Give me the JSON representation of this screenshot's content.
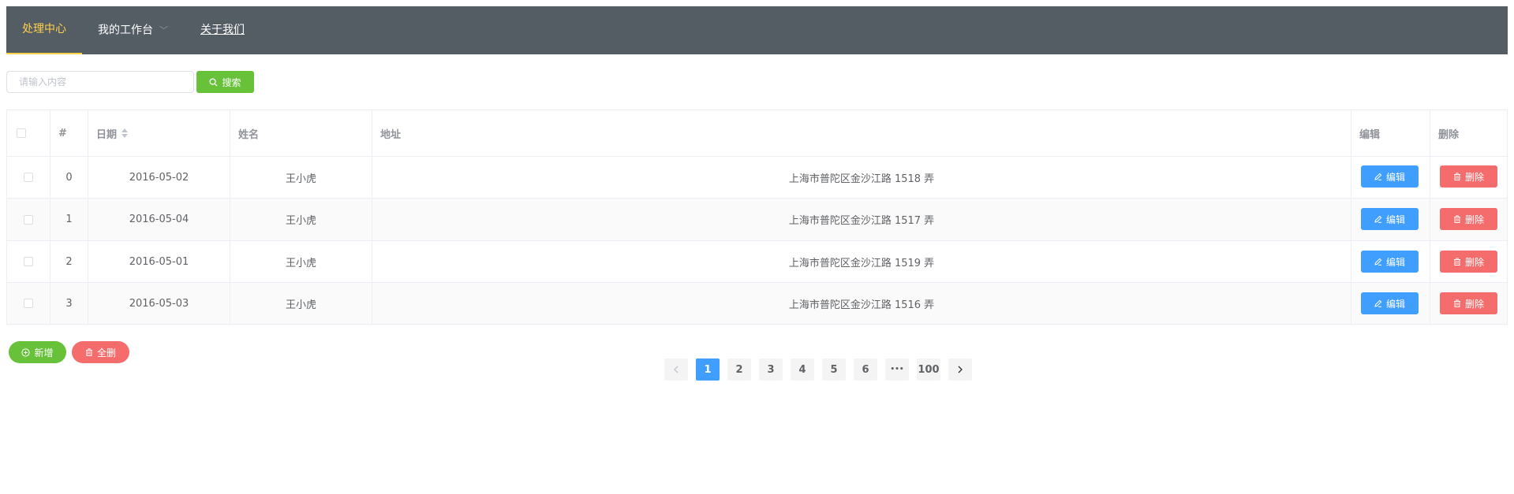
{
  "nav": {
    "items": [
      {
        "label": "处理中心"
      },
      {
        "label": "我的工作台"
      },
      {
        "label": "关于我们"
      }
    ]
  },
  "search": {
    "placeholder": "请输入内容",
    "button_label": "搜索"
  },
  "table": {
    "headers": {
      "index": "#",
      "date": "日期",
      "name": "姓名",
      "address": "地址",
      "edit": "编辑",
      "delete": "删除"
    },
    "rows": [
      {
        "index": "0",
        "date": "2016-05-02",
        "name": "王小虎",
        "address": "上海市普陀区金沙江路 1518 弄",
        "edit_label": "编辑",
        "delete_label": "删除"
      },
      {
        "index": "1",
        "date": "2016-05-04",
        "name": "王小虎",
        "address": "上海市普陀区金沙江路 1517 弄",
        "edit_label": "编辑",
        "delete_label": "删除"
      },
      {
        "index": "2",
        "date": "2016-05-01",
        "name": "王小虎",
        "address": "上海市普陀区金沙江路 1519 弄",
        "edit_label": "编辑",
        "delete_label": "删除"
      },
      {
        "index": "3",
        "date": "2016-05-03",
        "name": "王小虎",
        "address": "上海市普陀区金沙江路 1516 弄",
        "edit_label": "编辑",
        "delete_label": "删除"
      }
    ]
  },
  "actions": {
    "add_label": "新增",
    "delete_all_label": "全删"
  },
  "pagination": {
    "pages": [
      "1",
      "2",
      "3",
      "4",
      "5",
      "6"
    ],
    "ellipsis": "•••",
    "last_page": "100",
    "current": "1"
  },
  "colors": {
    "navbar": "#545c64",
    "nav_active": "#ffd04b",
    "success": "#67c23a",
    "primary": "#409eff",
    "danger": "#f56c6c"
  }
}
